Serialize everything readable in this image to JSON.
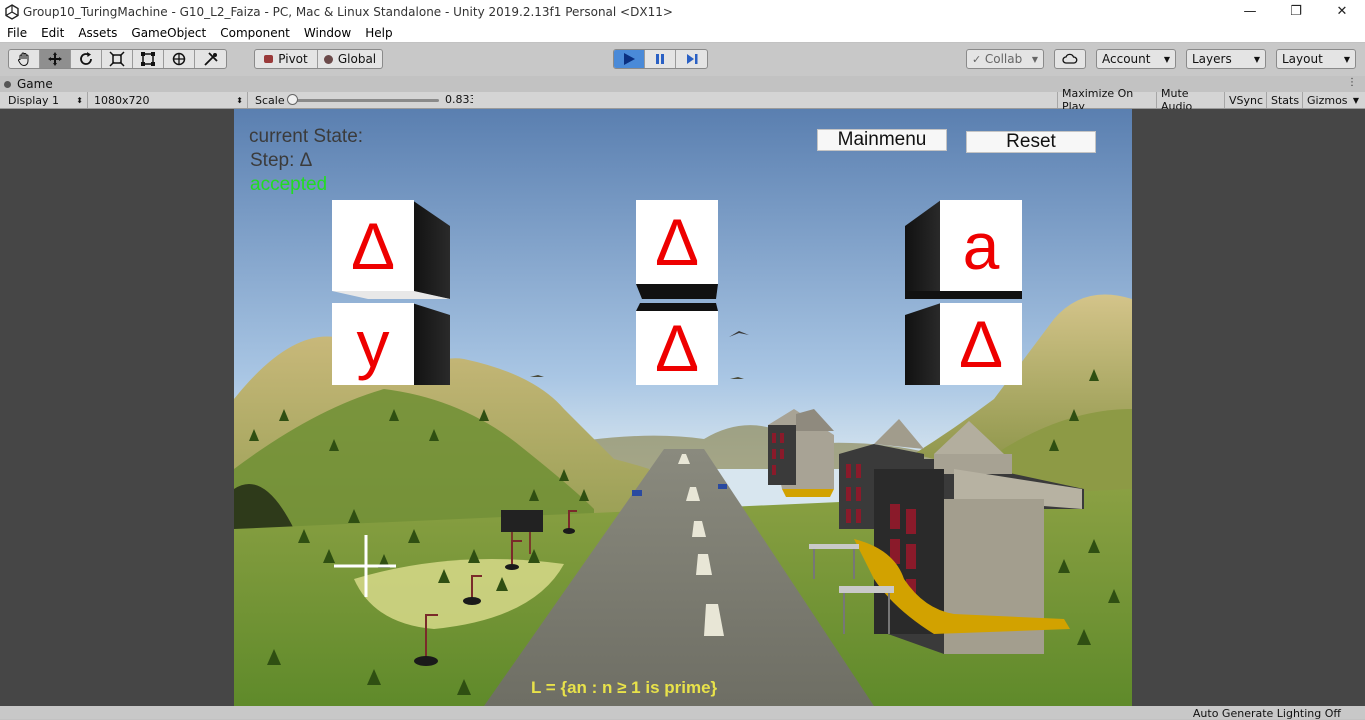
{
  "window": {
    "title": "Group10_TuringMachine - G10_L2_Faiza - PC, Mac & Linux Standalone - Unity 2019.2.13f1 Personal <DX11>",
    "minimize_glyph": "—",
    "restore_glyph": "❐",
    "close_glyph": "✕"
  },
  "menu": [
    "File",
    "Edit",
    "Assets",
    "GameObject",
    "Component",
    "Window",
    "Help"
  ],
  "toolbar": {
    "tools": [
      "hand-icon",
      "move-icon",
      "rotate-icon",
      "scale-icon",
      "rect-icon",
      "transform-icon",
      "custom-tool-icon"
    ],
    "active_tool": "move-icon",
    "pivot_label": "Pivot",
    "global_label": "Global",
    "play_active": true,
    "collab_label": "Collab",
    "account_label": "Account",
    "layers_label": "Layers",
    "layout_label": "Layout"
  },
  "game_tab": {
    "label": "Game"
  },
  "game_bar": {
    "display": "Display 1",
    "resolution": "1080x720",
    "scale_label": "Scale",
    "scale_value": "0.833",
    "scale_fraction": 0.02,
    "maximize_on_play": "Maximize On Play",
    "mute_audio": "Mute Audio",
    "vsync": "VSync",
    "stats": "Stats",
    "gizmos": "Gizmos"
  },
  "game": {
    "current_state_label": "current State:",
    "step_label": "Step: Δ",
    "accepted_label": "accepted",
    "mainmenu_button": "Mainmenu",
    "reset_button": "Reset",
    "tape_cells": [
      {
        "symbol": "Δ",
        "row": "upper"
      },
      {
        "symbol": "y",
        "row": "lower"
      },
      {
        "symbol": "Δ",
        "row": "upper"
      },
      {
        "symbol": "Δ",
        "row": "lower"
      },
      {
        "symbol": "a",
        "row": "upper"
      },
      {
        "symbol": "Δ",
        "row": "lower"
      }
    ],
    "language": "L = {an : n ≥ 1 is prime}"
  },
  "status": {
    "text": "Auto Generate Lighting Off"
  },
  "colors": {
    "editor_gray": "#c2c2c2",
    "play_blue": "#4a8ad8",
    "tape_text": "#ee0000",
    "accepted_green": "#22dd22",
    "language_yellow": "#e8e24a"
  }
}
